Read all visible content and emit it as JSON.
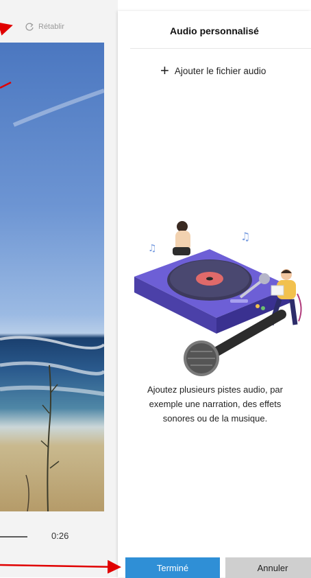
{
  "toolbar": {
    "redo_label": "Rétablir",
    "redo_icon": "redo-icon"
  },
  "preview": {
    "time": "0:26"
  },
  "panel": {
    "title": "Audio personnalisé",
    "add_audio_label": "Ajouter le fichier audio",
    "add_icon": "plus-icon",
    "hint_line1": "Ajoutez plusieurs pistes audio, par",
    "hint_line2": "exemple une narration, des effets",
    "hint_line3": "sonores ou de la musique."
  },
  "footer": {
    "done_label": "Terminé",
    "cancel_label": "Annuler"
  },
  "colors": {
    "accent": "#2f8fd6",
    "cancel_bg": "#cfcfcf",
    "annotation": "#e00000"
  }
}
